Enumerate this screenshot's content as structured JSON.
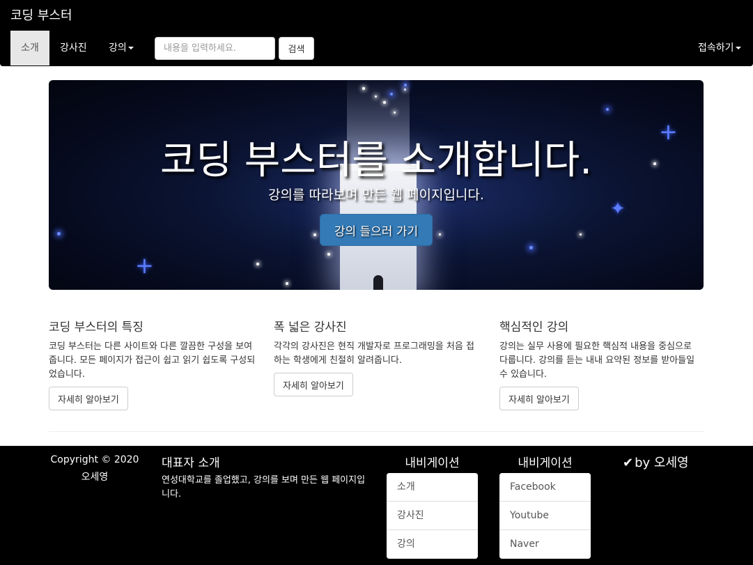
{
  "navbar": {
    "brand": "코딩 부스터",
    "items": [
      {
        "label": "소개"
      },
      {
        "label": "강사진"
      },
      {
        "label": "강의"
      }
    ],
    "search_placeholder": "내용을 입력하세요.",
    "search_button": "검색",
    "connect_label": "접속하기"
  },
  "jumbotron": {
    "title": "코딩 부스터를 소개합니다.",
    "subtitle": "강의를 따라보며 만든 웹 페이지입니다.",
    "button": "강의 들으러 가기"
  },
  "features": [
    {
      "title": "코딩 부스터의 특징",
      "text": "코딩 부스터는 다른 사이트와 다른 깔끔한 구성을 보여줍니다. 모든 페이지가 접근이 쉽고 읽기 쉽도록 구성되었습니다.",
      "button": "자세히 알아보기"
    },
    {
      "title": "폭 넓은 강사진",
      "text": "각각의 강사진은 현직 개발자로 프로그래밍을 처음 접하는 학생에게 친절히 알려줍니다.",
      "button": "자세히 알아보기"
    },
    {
      "title": "핵심적인 강의",
      "text": "강의는 실무 사용에 필요한 핵심적 내용을 중심으로 다룹니다. 강의를 듣는 내내 요약된 정보를 받아들일 수 있습니다.",
      "button": "자세히 알아보기"
    }
  ],
  "footer": {
    "copyright": "Copyright © 2020",
    "author": "오세영",
    "rep_title": "대표자 소개",
    "rep_text": "연성대학교를 졸업했고, 강의를 보며 만든 웹 페이지입니다.",
    "nav1": {
      "title": "내비게이션",
      "items": [
        "소개",
        "강사진",
        "강의"
      ]
    },
    "nav2": {
      "title": "내비게이션",
      "items": [
        "Facebook",
        "Youtube",
        "Naver"
      ]
    },
    "byline": "by 오세영",
    "byline_icon": "check-icon"
  }
}
